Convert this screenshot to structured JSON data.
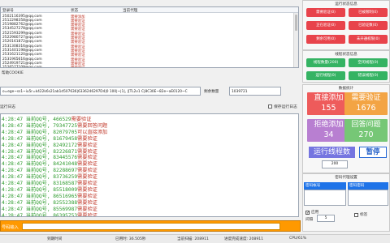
{
  "table": {
    "headers": [
      "登录号",
      "状态",
      "当前代理"
    ],
    "rows": [
      {
        "account": "2502116395@qq.com",
        "status": "需要添加"
      },
      {
        "account": "2512298358@qq.com",
        "status": "需要验证"
      },
      {
        "account": "2519882762@qq.com",
        "status": "需要验证"
      },
      {
        "account": "2534527278@qq.com",
        "status": "需要验证"
      },
      {
        "account": "2521593299@qq.com",
        "status": "需要验证"
      },
      {
        "account": "2522980727@qq.com",
        "status": "需要验证"
      },
      {
        "account": "2520161872@qq.com",
        "status": "需要验证"
      },
      {
        "account": "2531308316@qq.com",
        "status": "需要验证"
      },
      {
        "account": "2531401198@qq.com",
        "status": "需要验证"
      },
      {
        "account": "2531621120@qq.com",
        "status": "需要验证"
      },
      {
        "account": "2531965616@qq.com",
        "status": "需要验证"
      },
      {
        "account": "2524919721@qq.com",
        "status": "需要验证"
      },
      {
        "account": "2526577109@qq.com",
        "status": "需要验证"
      }
    ]
  },
  "cookie": {
    "label": "帮助COOKIE",
    "value": "o=ege~ss1~iu5r=k422k6s21ab1d507636|6336246297D4|0 100|~|1|, |[TL2v1 C|8C30E~82e~aE0120~C",
    "count_label": "剩余数量",
    "count_value": "1039721"
  },
  "log": {
    "title": "运行日志",
    "save_label": "保存运行日志",
    "lines": [
      {
        "time": "4:28:47",
        "qq": "466529",
        "msg": "需要验证"
      },
      {
        "time": "4:28:47",
        "qq": "79347725",
        "msg": "需要回答问题"
      },
      {
        "time": "4:28:47",
        "qq": "82079705",
        "msg": "可以直接添加"
      },
      {
        "time": "4:28:47",
        "qq": "81679458",
        "msg": "需要验证"
      },
      {
        "time": "4:28:47",
        "qq": "82492172",
        "msg": "需要验证"
      },
      {
        "time": "4:28:47",
        "qq": "82226871",
        "msg": "需要验证"
      },
      {
        "time": "4:28:47",
        "qq": "83445576",
        "msg": "需要验证"
      },
      {
        "time": "4:28:47",
        "qq": "84241048",
        "msg": "需要验证"
      },
      {
        "time": "4:28:47",
        "qq": "82288697",
        "msg": "需要验证"
      },
      {
        "time": "4:28:47",
        "qq": "83736259",
        "msg": "需要验证"
      },
      {
        "time": "4:28:47",
        "qq": "83168587",
        "msg": "需要验证"
      },
      {
        "time": "4:28:47",
        "qq": "85518009",
        "msg": "需要验证"
      },
      {
        "time": "4:28:47",
        "qq": "86516965",
        "msg": "需要验证"
      },
      {
        "time": "4:28:47",
        "qq": "82552388",
        "msg": "需要验证"
      },
      {
        "time": "4:28:47",
        "qq": "85569987",
        "msg": "需要验证"
      },
      {
        "time": "4:28:47",
        "qq": "86395753",
        "msg": "需要验证"
      }
    ]
  },
  "input_bar": {
    "label": "号码输入"
  },
  "status_bar": {
    "s1": "到期时间",
    "s2": "已用时: 36.505秒",
    "s3": "当前扫描: 208911",
    "s4": "进度完成速度: 208911",
    "s5": "CPU/61%"
  },
  "run_info": {
    "title": "运行状态信息",
    "buttons": [
      "需要验证(0)",
      "已被限制(0)",
      "正在验证(0)",
      "已验证数(0)",
      "剩余可用(0)",
      "未开通权限(0)"
    ]
  },
  "thread_info": {
    "title": "线程状态信息",
    "buttons": [
      "线程数量(200)",
      "空闲线程(0)",
      "运行线程(0)",
      "错误线程(0)"
    ]
  },
  "stats": {
    "title": "数据统计",
    "items": [
      {
        "label": "直接添加",
        "value": "155",
        "color": "#ee5b5b"
      },
      {
        "label": "需要验证",
        "value": "1676",
        "color": "#f3a444"
      },
      {
        "label": "拒绝添加",
        "value": "34",
        "color": "#b87fd1"
      },
      {
        "label": "回答问题",
        "value": "270",
        "color": "#76c776"
      }
    ]
  },
  "threads": {
    "label": "运行线程数",
    "pause": "暂停",
    "value": "200"
  },
  "proxy": {
    "title": "密码代理设置",
    "account_header": "密码帐号",
    "password_header": "密码密码",
    "apply_label": "应用",
    "interval_label": "间隔",
    "interval_value": "5",
    "sign_label": "标签"
  }
}
